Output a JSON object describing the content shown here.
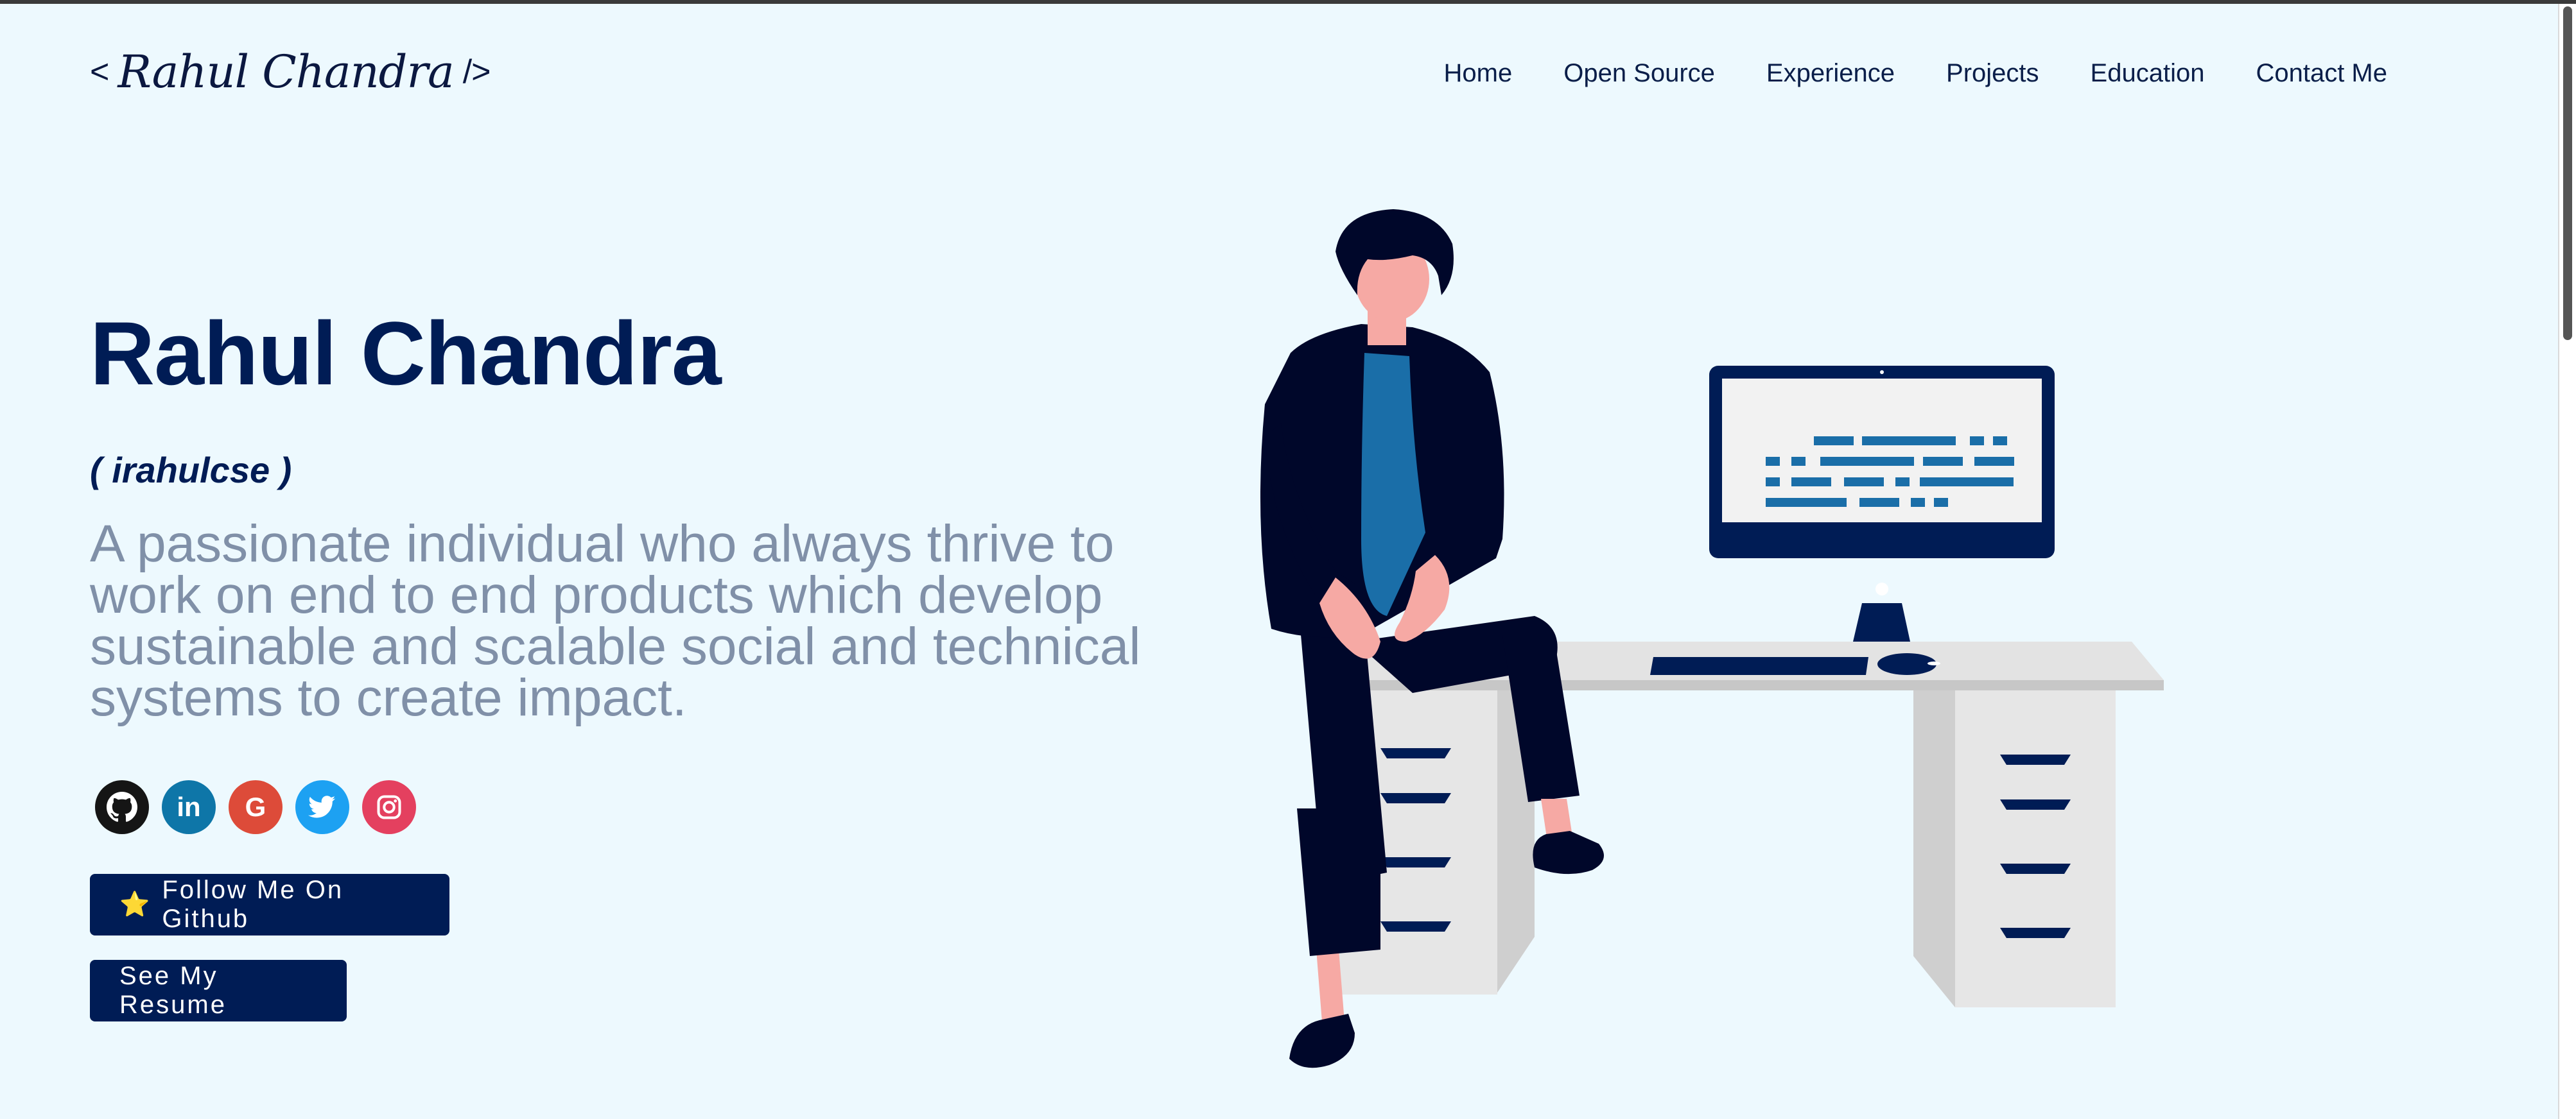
{
  "header": {
    "logo": {
      "open": "<",
      "signature": "Rahul Chandra",
      "close": "/>"
    },
    "nav": [
      "Home",
      "Open Source",
      "Experience",
      "Projects",
      "Education",
      "Contact Me"
    ]
  },
  "hero": {
    "name": "Rahul Chandra",
    "handle": "( irahulcse )",
    "tagline": "A passionate individual who always thrive to work on end to end products which develop sustainable and scalable social and technical systems to create impact.",
    "socials": [
      {
        "name": "github",
        "icon": "github-icon",
        "glyph": "",
        "color": "#151515"
      },
      {
        "name": "linkedin",
        "icon": "linkedin-icon",
        "glyph": "in",
        "color": "#0e76a8"
      },
      {
        "name": "google",
        "icon": "google-icon",
        "glyph": "G",
        "color": "#dd4b39"
      },
      {
        "name": "twitter",
        "icon": "twitter-icon",
        "glyph": "",
        "color": "#1da1f2"
      },
      {
        "name": "instagram",
        "icon": "instagram-icon",
        "glyph": "",
        "color": "#e4405f"
      }
    ],
    "buttons": {
      "github_star": "⭐",
      "github": "Follow Me On Github",
      "resume": "See My Resume"
    }
  },
  "colors": {
    "background": "#edf9fe",
    "primary": "#001c55",
    "tagline": "#8090a8",
    "accent_blue": "#1a6ea8"
  }
}
